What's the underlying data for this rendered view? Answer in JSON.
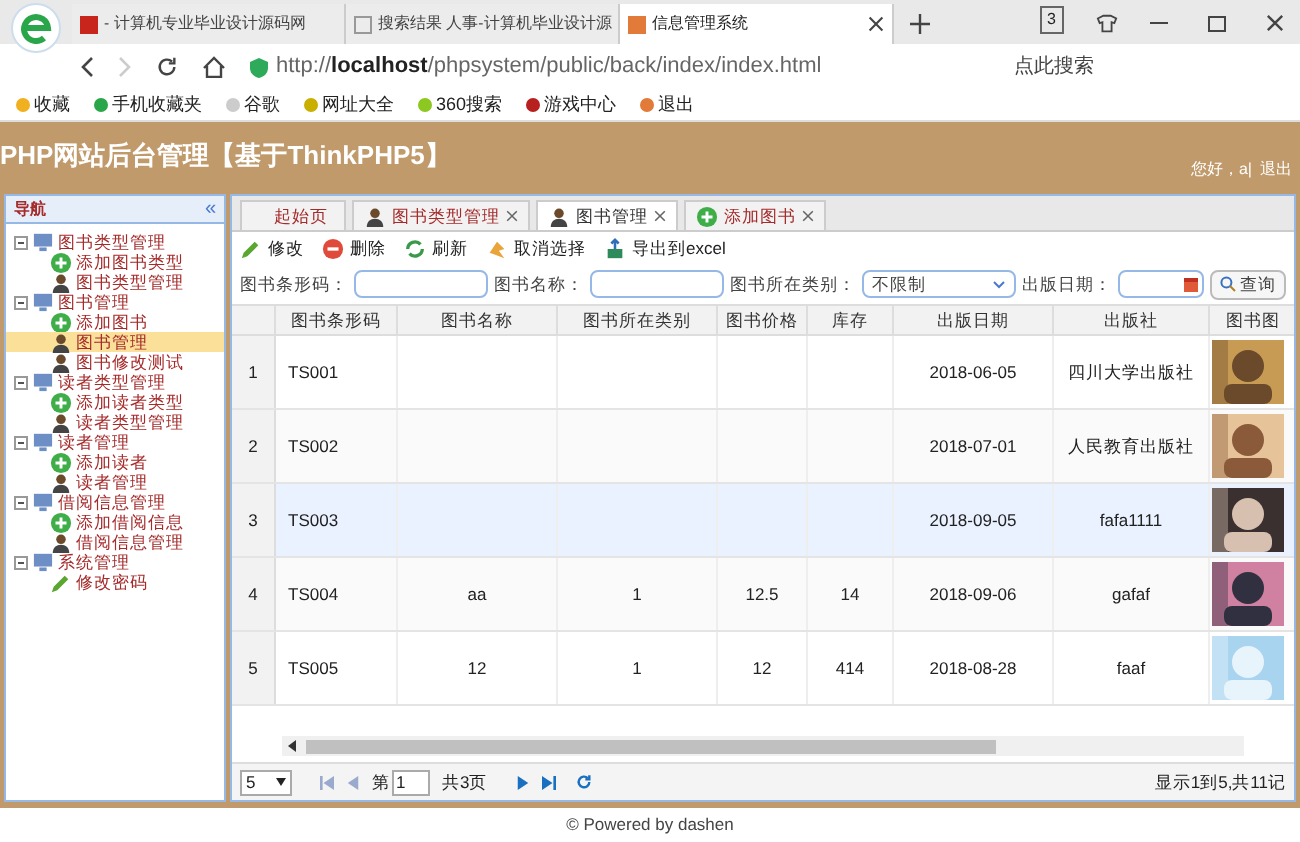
{
  "browser": {
    "tabs": [
      {
        "title": "- 计算机专业毕业设计源码网",
        "selected": false
      },
      {
        "title": "搜索结果 人事-计算机毕业设计源",
        "selected": false
      },
      {
        "title": "信息管理系统",
        "selected": true
      }
    ],
    "tab_count": "3",
    "url_prefix": "http://",
    "url_host": "localhost",
    "url_path": "/phpsystem/public/back/index/index.html",
    "search_placeholder": "点此搜索",
    "bookmarks": [
      "收藏",
      "手机收藏夹",
      "谷歌",
      "网址大全",
      "360搜索",
      "游戏中心",
      "退出"
    ]
  },
  "header": {
    "title": "PHP网站后台管理【基于ThinkPHP5】",
    "greeting": "您好，a|",
    "logout": "退出"
  },
  "sidebar": {
    "title": "导航",
    "collapse": "«",
    "items": [
      {
        "label": "图书类型管理",
        "expanded": true,
        "children": [
          {
            "label": "添加图书类型",
            "kind": "add",
            "selected": false
          },
          {
            "label": "图书类型管理",
            "kind": "user",
            "selected": false
          }
        ]
      },
      {
        "label": "图书管理",
        "expanded": true,
        "children": [
          {
            "label": "添加图书",
            "kind": "add",
            "selected": false
          },
          {
            "label": "图书管理",
            "kind": "user",
            "selected": true
          },
          {
            "label": "图书修改测试",
            "kind": "user",
            "selected": false
          }
        ]
      },
      {
        "label": "读者类型管理",
        "expanded": true,
        "children": [
          {
            "label": "添加读者类型",
            "kind": "add",
            "selected": false
          },
          {
            "label": "读者类型管理",
            "kind": "user",
            "selected": false
          }
        ]
      },
      {
        "label": "读者管理",
        "expanded": true,
        "children": [
          {
            "label": "添加读者",
            "kind": "add",
            "selected": false
          },
          {
            "label": "读者管理",
            "kind": "user",
            "selected": false
          }
        ]
      },
      {
        "label": "借阅信息管理",
        "expanded": true,
        "children": [
          {
            "label": "添加借阅信息",
            "kind": "add",
            "selected": false
          },
          {
            "label": "借阅信息管理",
            "kind": "user",
            "selected": false
          }
        ]
      },
      {
        "label": "系统管理",
        "expanded": true,
        "children": [
          {
            "label": "修改密码",
            "kind": "edit",
            "selected": false
          }
        ]
      }
    ]
  },
  "tabs": [
    {
      "label": "起始页",
      "kind": "plain",
      "selected": false,
      "closable": false
    },
    {
      "label": "图书类型管理",
      "kind": "user",
      "selected": false,
      "closable": true
    },
    {
      "label": "图书管理",
      "kind": "user",
      "selected": true,
      "closable": true
    },
    {
      "label": "添加图书",
      "kind": "add",
      "selected": false,
      "closable": true
    }
  ],
  "toolbar": [
    {
      "label": "修改",
      "kind": "edit"
    },
    {
      "label": "删除",
      "kind": "delete"
    },
    {
      "label": "刷新",
      "kind": "refresh"
    },
    {
      "label": "取消选择",
      "kind": "undo"
    },
    {
      "label": "导出到excel",
      "kind": "export"
    }
  ],
  "search": {
    "fields": [
      {
        "label": "图书条形码：",
        "kind": "text"
      },
      {
        "label": "图书名称：",
        "kind": "text"
      },
      {
        "label": "图书所在类别：",
        "kind": "select",
        "value": "不限制"
      },
      {
        "label": "出版日期：",
        "kind": "date"
      }
    ],
    "button": "查询"
  },
  "table": {
    "columns": [
      "图书条形码",
      "图书名称",
      "图书所在类别",
      "图书价格",
      "库存",
      "出版日期",
      "出版社",
      "图书图"
    ],
    "rows": [
      {
        "index": "1",
        "cells": [
          "TS001",
          null,
          null,
          null,
          null,
          "2018-06-05",
          "四川大学出版社"
        ],
        "selected": false
      },
      {
        "index": "2",
        "cells": [
          "TS002",
          null,
          null,
          null,
          null,
          "2018-07-01",
          "人民教育出版社"
        ],
        "selected": false
      },
      {
        "index": "3",
        "cells": [
          "TS003",
          null,
          null,
          null,
          null,
          "2018-09-05",
          "fafa1111"
        ],
        "selected": true
      },
      {
        "index": "4",
        "cells": [
          "TS004",
          "aa",
          "1",
          "12.5",
          "14",
          "2018-09-06",
          "gafaf"
        ],
        "selected": false
      },
      {
        "index": "5",
        "cells": [
          "TS005",
          "12",
          "1",
          "12",
          "414",
          "2018-08-28",
          "faaf"
        ],
        "selected": false
      }
    ]
  },
  "pager": {
    "page_size": "5",
    "page_prefix": "第",
    "page": "1",
    "page_total": "共3页",
    "summary": "显示1到5,共11记"
  },
  "footer": "© Powered by dashen"
}
